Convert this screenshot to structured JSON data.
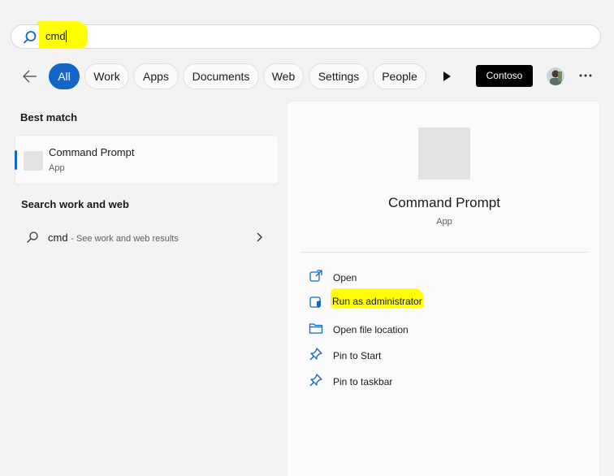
{
  "search": {
    "query": "cmd"
  },
  "filters": {
    "tabs": [
      "All",
      "Work",
      "Apps",
      "Documents",
      "Web",
      "Settings",
      "People"
    ],
    "active_tab": "All",
    "org_label": "Contoso"
  },
  "results": {
    "best_match_title": "Best match",
    "best_match": {
      "name": "Command Prompt",
      "type": "App"
    },
    "web_section_title": "Search work and web",
    "web_item": {
      "query": "cmd",
      "suffix": "- See work and web results"
    }
  },
  "detail": {
    "name": "Command Prompt",
    "type": "App",
    "actions": [
      "Open",
      "Run as administrator",
      "Open file location",
      "Pin to Start",
      "Pin to taskbar"
    ]
  },
  "colors": {
    "accent": "#1366c8",
    "highlight": "#ffff00"
  }
}
